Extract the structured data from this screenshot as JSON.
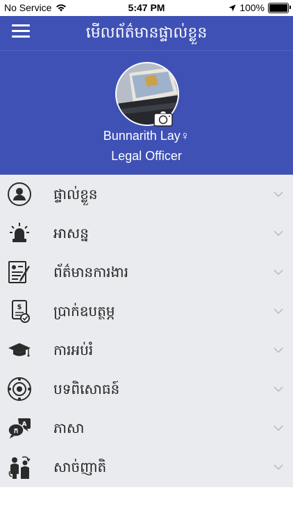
{
  "status_bar": {
    "carrier": "No Service",
    "time": "5:47 PM",
    "battery": "100%"
  },
  "nav": {
    "title": "មើលព័ត៌មានផ្ទាល់ខ្លួន",
    "menu_icon": "hamburger-menu-icon"
  },
  "profile": {
    "name": "Bunnarith Lay♀",
    "role": "Legal Officer",
    "camera_icon": "camera-icon"
  },
  "menu": [
    {
      "label": "ផ្ទាល់ខ្លួន",
      "icon": "personal-user-icon"
    },
    {
      "label": "អាសន្ន",
      "icon": "emergency-siren-icon"
    },
    {
      "label": "ព័ត៌មានការងារ",
      "icon": "work-document-icon"
    },
    {
      "label": "ប្រាក់ឧបត្ថម្ភ",
      "icon": "allowance-money-icon"
    },
    {
      "label": "ការអប់រំ",
      "icon": "graduation-cap-icon"
    },
    {
      "label": "បទពិសោធន៍",
      "icon": "experience-icon"
    },
    {
      "label": "ភាសា",
      "icon": "language-icon"
    },
    {
      "label": "សាច់ញាតិ",
      "icon": "relatives-family-icon"
    }
  ],
  "colors": {
    "header": "#3f51b5",
    "list_background": "#e9ebee",
    "icon": "#2b2b2b",
    "chevron": "#b5b8bd"
  }
}
